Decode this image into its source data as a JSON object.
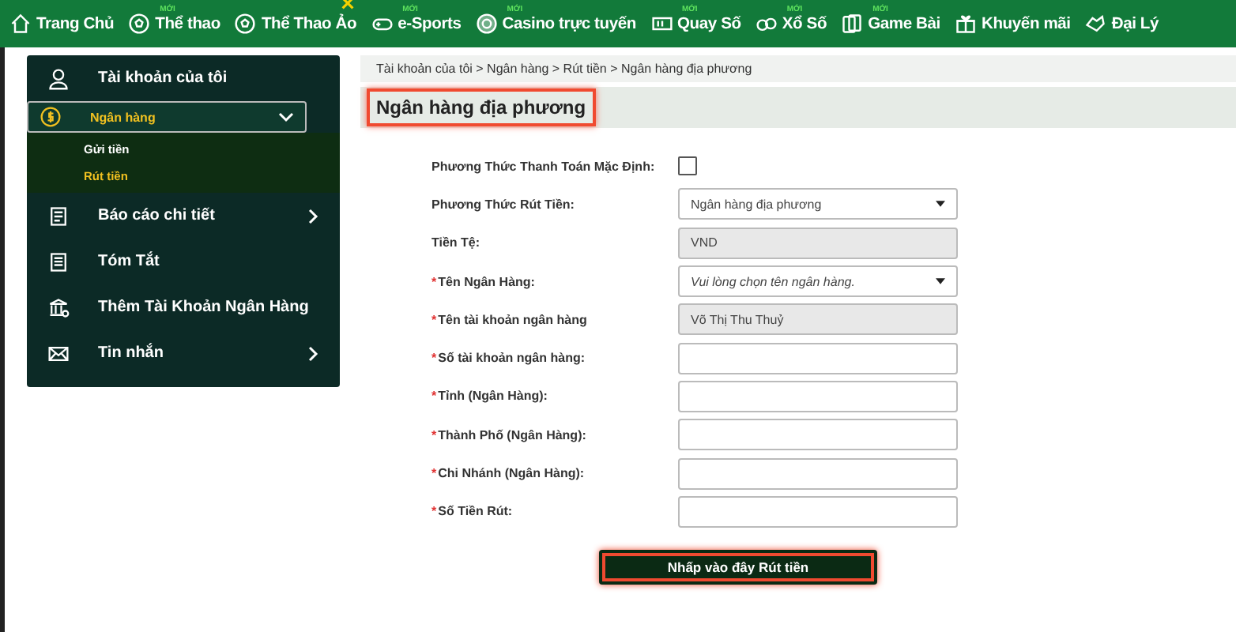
{
  "nav": [
    {
      "label": "Trang Chủ"
    },
    {
      "label": "Thể thao",
      "badge": "MỚI"
    },
    {
      "label": "Thể Thao Ảo",
      "starred": true
    },
    {
      "label": "e-Sports",
      "badge": "MỚI"
    },
    {
      "label": "Casino trực tuyến",
      "badge": "MỚI"
    },
    {
      "label": "Quay Số",
      "badge": "MỚI"
    },
    {
      "label": "Xổ Số",
      "badge": "MỚI"
    },
    {
      "label": "Game Bài",
      "badge": "MỚI"
    },
    {
      "label": "Khuyến mãi"
    },
    {
      "label": "Đại Lý"
    }
  ],
  "sidebar": {
    "items": [
      {
        "label": "Tài khoản của tôi",
        "selected": false
      },
      {
        "label": "Ngân hàng",
        "selected": true,
        "expanded": true,
        "children": [
          {
            "label": "Gửi tiền",
            "selected": false
          },
          {
            "label": "Rút tiền",
            "selected": true
          }
        ]
      },
      {
        "label": "Báo cáo chi tiết",
        "selected": false,
        "expanded": false
      },
      {
        "label": "Tóm Tắt",
        "selected": false
      },
      {
        "label": "Thêm Tài Khoản Ngân Hàng",
        "selected": false
      },
      {
        "label": "Tin nhắn",
        "selected": false,
        "expanded": false
      }
    ]
  },
  "breadcrumb": "Tài khoản của tôi > Ngân hàng > Rút tiền > Ngân hàng địa phương",
  "title": {
    "text": "Ngân hàng địa phương",
    "highlighted": true
  },
  "form": [
    {
      "kind": "checkbox",
      "label": "Phương Thức Thanh Toán Mặc Định:",
      "checked": false
    },
    {
      "kind": "select",
      "label": "Phương Thức Rút Tiền:",
      "value": "Ngân hàng địa phương"
    },
    {
      "kind": "readonly",
      "label": "Tiền Tệ:",
      "value": "VND"
    },
    {
      "kind": "select",
      "label": "Tên Ngân Hàng:",
      "required_mark": "*",
      "placeholder": "Vui lòng chọn tên ngân hàng."
    },
    {
      "kind": "readonly",
      "label": "Tên tài khoản ngân hàng",
      "required_mark": "*",
      "value": "Võ Thị Thu Thuỷ"
    },
    {
      "kind": "text",
      "label": "Số tài khoản ngân hàng:",
      "required_mark": "*"
    },
    {
      "kind": "text",
      "label": "Tỉnh (Ngân Hàng):",
      "required_mark": "*"
    },
    {
      "kind": "text",
      "label": "Thành Phố (Ngân Hàng):",
      "required_mark": "*"
    },
    {
      "kind": "text",
      "label": "Chi Nhánh (Ngân Hàng):",
      "required_mark": "*"
    },
    {
      "kind": "text",
      "label": "Số Tiền Rút:",
      "required_mark": "*"
    }
  ],
  "submit": {
    "label": "Nhấp vào đây Rút tiền",
    "highlighted": true
  }
}
